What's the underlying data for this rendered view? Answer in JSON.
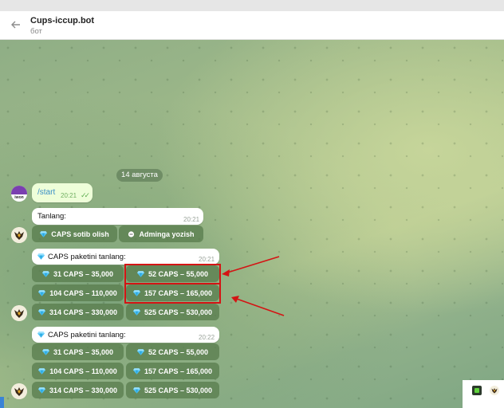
{
  "header": {
    "title": "Cups-iccup.bot",
    "subtitle": "бот",
    "back_icon": "arrow-left-icon"
  },
  "chat": {
    "date_divider": "14 августа",
    "outgoing": {
      "text": "/start",
      "time": "20:21",
      "avatar_label": "iwon"
    },
    "messages": [
      {
        "text": "Tanlang:",
        "time": "20:21",
        "buttons": [
          [
            "CAPS sotib olish",
            "Adminga yozish"
          ]
        ]
      },
      {
        "text": "CAPS paketini tanlang:",
        "time": "20:21",
        "buttons": [
          [
            "31 CAPS – 35,000",
            "52 CAPS – 55,000"
          ],
          [
            "104 CAPS – 110,000",
            "157 CAPS – 165,000"
          ],
          [
            "314 CAPS – 330,000",
            "525 CAPS – 530,000"
          ]
        ]
      },
      {
        "text": "CAPS paketini tanlang:",
        "time": "20:22",
        "buttons": [
          [
            "31 CAPS – 35,000",
            "52 CAPS – 55,000"
          ],
          [
            "104 CAPS – 110,000",
            "157 CAPS – 165,000"
          ],
          [
            "314 CAPS – 330,000",
            "525 CAPS – 530,000"
          ]
        ]
      }
    ]
  },
  "colors": {
    "highlight": "#d41414",
    "keyboard_button": "#5a7d4e",
    "accent": "#3a8fc7"
  },
  "icons": {
    "gem": "diamond-icon",
    "admin": "chat-bubble-icon",
    "bot_avatar": "eagle-avatar"
  }
}
